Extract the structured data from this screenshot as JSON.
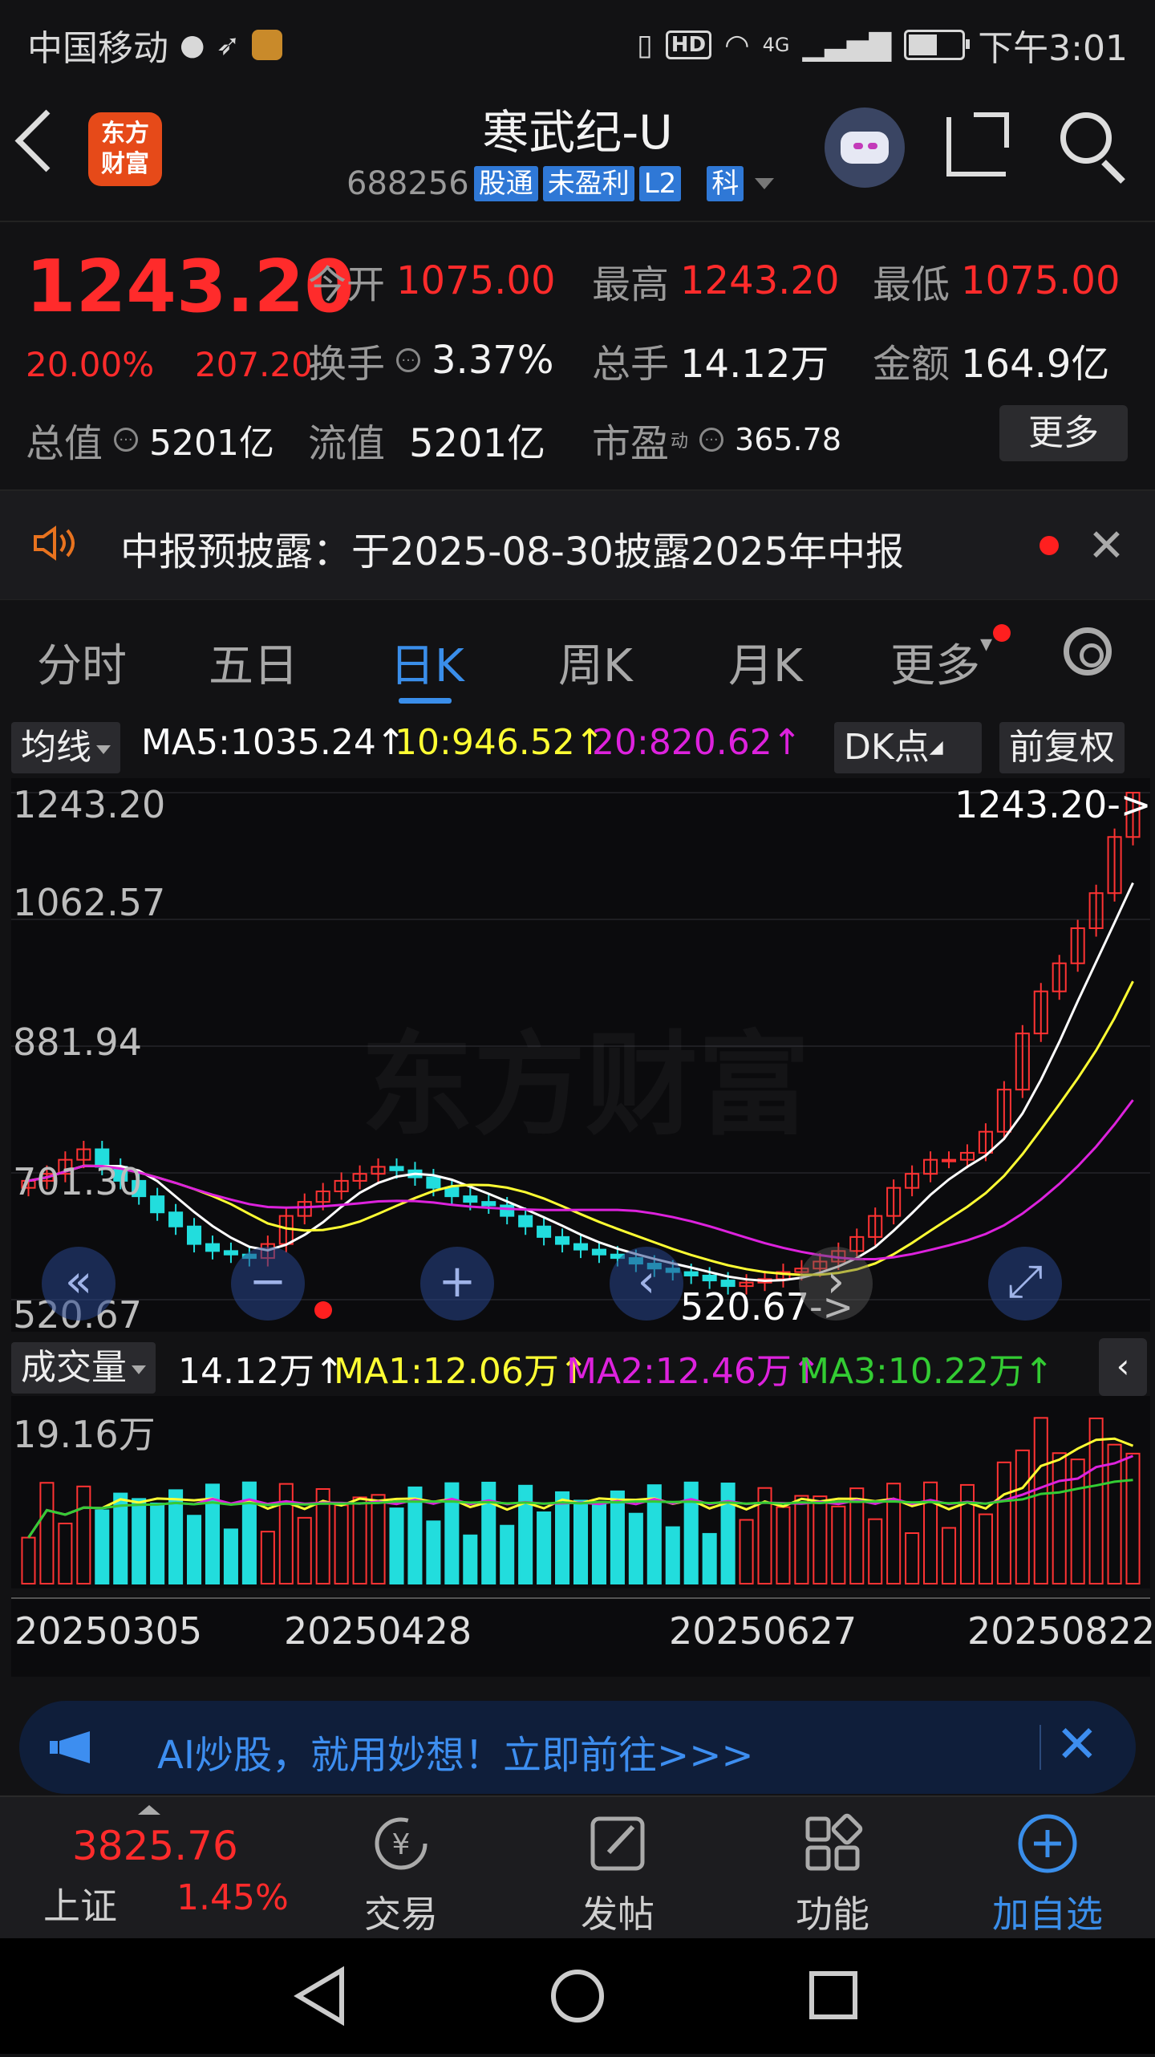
{
  "status_bar": {
    "carrier": "中国移动",
    "time": "下午3:01",
    "hd": "HD",
    "network": "4G",
    "icons": [
      "wechat-icon",
      "plane-arrow-icon",
      "app-badge-icon",
      "vibrate-icon",
      "hd-icon",
      "wifi-icon",
      "signal-icon",
      "battery-icon"
    ],
    "battery_level": 0.55
  },
  "header": {
    "logo_text_line1": "东方",
    "logo_text_line2": "财富",
    "stock_name": "寒武纪-U",
    "stock_code": "688256",
    "tags": [
      "股通",
      "未盈利",
      "L2",
      "科"
    ]
  },
  "quote": {
    "price": "1243.20",
    "change_pct": "20.00%",
    "change_abs": "207.20",
    "open_label": "今开",
    "open": "1075.00",
    "high_label": "最高",
    "high": "1243.20",
    "low_label": "最低",
    "low": "1075.00",
    "turnover_label": "换手",
    "turnover": "3.37%",
    "volume_label": "总手",
    "volume": "14.12万",
    "amount_label": "金额",
    "amount": "164.9亿",
    "mcap_label": "总值",
    "mcap": "5201亿",
    "float_label": "流值",
    "float": "5201亿",
    "pe_label": "市盈",
    "pe_sup": "动",
    "pe": "365.78",
    "more_button": "更多"
  },
  "notice": {
    "text": "中报预披露：于2025-08-30披露2025年中报"
  },
  "tabs": {
    "items": [
      "分时",
      "五日",
      "日K",
      "周K",
      "月K",
      "更多"
    ],
    "active_index": 2
  },
  "indicators": {
    "ma_select": "均线",
    "ma5": "MA5:1035.24↑",
    "ma10": "10:946.52↑",
    "ma20": "20:820.62↑",
    "dk_button": "DK点",
    "adjust_button": "前复权",
    "ma5_color": "#ffffff",
    "ma10_color": "#ffff33",
    "ma20_color": "#dd22dd"
  },
  "chart": {
    "y_labels": [
      "1243.20",
      "1062.57",
      "881.94",
      "701.30",
      "520.67"
    ],
    "last_price_marker": "1243.20->",
    "low_marker": "520.67->",
    "watermark": "东方财富",
    "controls": [
      "double-left-arrow-icon",
      "minus-icon",
      "plus-icon",
      "left-arrow-icon",
      "right-arrow-icon",
      "expand-icon"
    ]
  },
  "volume": {
    "select": "成交量",
    "total": "14.12万↑",
    "ma1": "MA1:12.06万↑",
    "ma2": "MA2:12.46万↑",
    "ma3": "MA3:10.22万↑",
    "ma1_color": "#ffff33",
    "ma2_color": "#dd22dd",
    "ma3_color": "#33cc33",
    "max_label": "19.16万"
  },
  "dates": [
    "20250305",
    "20250428",
    "20250627",
    "20250822"
  ],
  "ai_banner": {
    "text": "AI炒股，就用妙想！立即前往>>>"
  },
  "bottom_nav": {
    "index_value": "3825.76",
    "index_name": "上证",
    "index_pct": "1.45%",
    "items": [
      "交易",
      "发帖",
      "功能",
      "加自选"
    ]
  },
  "chart_data": {
    "type": "candlestick",
    "x_labels": [
      "20250305",
      "20250428",
      "20250627",
      "20250822"
    ],
    "ylim": [
      520.67,
      1243.2
    ],
    "y_ticks": [
      1243.2,
      1062.57,
      881.94,
      701.3,
      520.67
    ],
    "last_close": 1243.2,
    "period_low": 520.67,
    "series": [
      {
        "name": "MA5",
        "value": 1035.24
      },
      {
        "name": "MA10",
        "value": 946.52
      },
      {
        "name": "MA20",
        "value": 820.62
      }
    ],
    "closes": [
      690,
      700,
      720,
      735,
      710,
      690,
      668,
      645,
      625,
      600,
      590,
      585,
      580,
      600,
      640,
      660,
      675,
      690,
      700,
      710,
      705,
      695,
      680,
      668,
      660,
      655,
      640,
      625,
      610,
      600,
      592,
      585,
      580,
      572,
      565,
      560,
      555,
      548,
      540,
      545,
      550,
      560,
      565,
      575,
      590,
      610,
      640,
      680,
      700,
      720,
      720,
      730,
      760,
      820,
      900,
      960,
      1000,
      1050,
      1100,
      1180,
      1243.2
    ],
    "volume": {
      "max": "19.16万",
      "last": 14.12,
      "ma1": 12.06,
      "ma2": 12.46,
      "ma3": 10.22
    }
  }
}
